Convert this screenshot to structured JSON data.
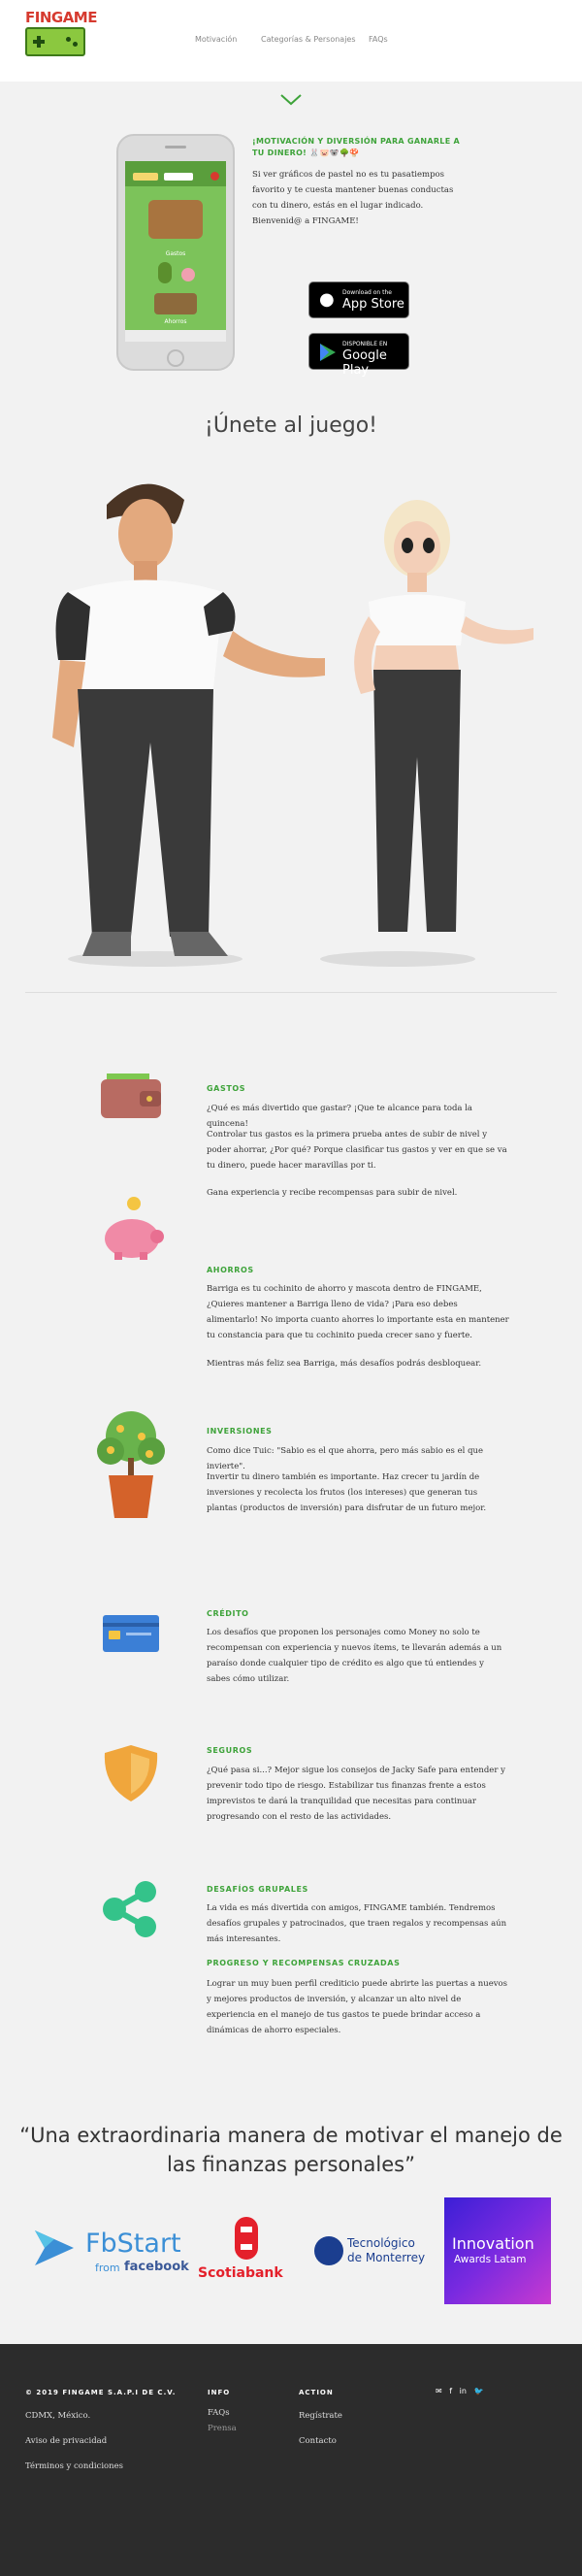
{
  "header": {
    "brand": "FINGAME",
    "nav": [
      "Motivación",
      "Categorías & Personajes",
      "FAQs"
    ]
  },
  "promo": {
    "title": "¡MOTIVACIÓN Y DIVERSIÓN PARA GANARLE A TU DINERO! 🐰🐷🐨🌳🍄",
    "body": "Si ver gráficos de pastel no es tu pasatiempos favorito y te cuesta mantener buenas conductas con tu dinero, estás en el lugar indicado. Bienvenid@ a FINGAME!",
    "phone_labels": [
      "Gastos",
      "Ahorros"
    ],
    "appstore_small": "Download on the",
    "appstore_large": "App Store",
    "googleplay_small": "DISPONIBLE EN",
    "googleplay_large": "Google Play"
  },
  "join_title": "¡Únete al juego!",
  "features": [
    {
      "icon": "wallet-icon",
      "title": "GASTOS",
      "paragraphs": [
        "¿Qué es más divertido que gastar? ¡Que te alcance para toda la quincena!",
        "Controlar tus gastos es la primera prueba antes de subir de nivel y poder ahorrar, ¿Por qué? Porque clasificar tus gastos y ver en que se va tu dinero, puede hacer maravillas por ti.",
        "Gana experiencia y recibe recompensas para subir de nivel."
      ]
    },
    {
      "icon": "piggy-bank-icon",
      "title": "AHORROS",
      "paragraphs": [
        "Barriga es tu cochinito de ahorro y mascota dentro de FINGAME, ¿Quieres mantener a Barriga lleno de vida? ¡Para eso debes alimentarlo! No importa cuanto ahorres lo importante esta en mantener tu constancia para que tu cochinito pueda crecer sano y fuerte.",
        "Mientras más feliz sea Barriga, más desafíos podrás desbloquear."
      ]
    },
    {
      "icon": "money-tree-icon",
      "title": "INVERSIONES",
      "paragraphs": [
        "Como dice Tuic: \"Sabio es el que ahorra, pero más sabio es el que invierte\".",
        "Invertir tu dinero también es importante. Haz crecer tu jardín de inversiones y recolecta los frutos (los intereses) que generan tus plantas (productos de inversión) para disfrutar de un futuro mejor."
      ]
    },
    {
      "icon": "credit-card-icon",
      "title": "CRÉDITO",
      "paragraphs": [
        "Los desafíos que proponen los personajes como Money no solo te recompensan con experiencia y nuevos ítems, te llevarán además a un paraíso donde cualquier tipo de crédito es algo que tú entiendes y sabes cómo utilizar."
      ]
    },
    {
      "icon": "shield-icon",
      "title": "SEGUROS",
      "paragraphs": [
        "¿Qué pasa si...? Mejor sigue los consejos de Jacky Safe para entender y prevenir todo tipo de riesgo. Estabilizar tus finanzas frente a estos imprevistos te dará la tranquilidad que necesitas para continuar progresando con el resto de las actividades."
      ]
    },
    {
      "icon": "share-icon",
      "title": "DESAFÍOS GRUPALES",
      "paragraphs": [
        "La vida es más divertida con amigos, FINGAME también. Tendremos desafíos grupales y patrocinados, que traen regalos y recompensas aún más interesantes."
      ],
      "title2": "PROGRESO Y RECOMPENSAS CRUZADAS",
      "paragraphs2": [
        "Lograr un muy buen perfil crediticio puede abrirte las puertas a nuevos y mejores productos de inversión, y alcanzar un alto nivel de experiencia en el manejo de tus gastos te puede brindar acceso a dinámicas de ahorro especiales."
      ]
    }
  ],
  "quote": "“Una extraordinaria manera de motivar el manejo de las finanzas personales”",
  "partners": {
    "fbstart": "FbStart",
    "fbstart_sub": "from",
    "fbstart_fb": "facebook",
    "scotiabank": "Scotiabank",
    "tec_line1": "Tecnológico",
    "tec_line2": "de Monterrey",
    "innovation_1": "Innovation",
    "innovation_2": "Awards Latam"
  },
  "footer": {
    "copyright": "© 2019 FINGAME S.A.P.I DE C.V.",
    "col1": [
      "CDMX, México.",
      "Aviso de privacidad",
      "Términos y condiciones"
    ],
    "info_title": "INFO",
    "info": [
      "FAQs",
      "Prensa"
    ],
    "action_title": "ACTION",
    "action": [
      "Regístrate",
      "Contacto"
    ]
  },
  "colors": {
    "accent_green": "#3ea33a",
    "brand_red": "#d63a2f",
    "footer_bg": "#2c2c2c"
  }
}
